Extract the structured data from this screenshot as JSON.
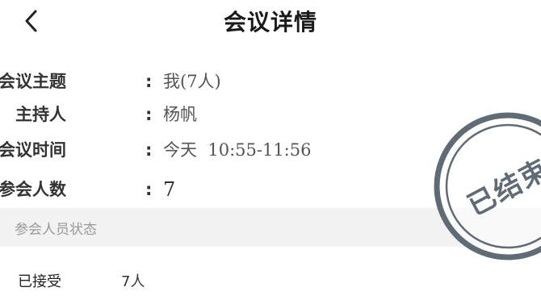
{
  "header": {
    "title": "会议详情"
  },
  "meeting": {
    "subject": {
      "label": "会议主题",
      "value": "我(7人)"
    },
    "host": {
      "label": "主持人",
      "value": "杨帆"
    },
    "time": {
      "label": "会议时间",
      "value": "今天  10:55-11:56"
    },
    "count": {
      "label": "参会人数",
      "value": "7"
    }
  },
  "colon": ":",
  "section": {
    "title": "参会人员状态"
  },
  "status": {
    "label": "已接受",
    "count": "7人"
  },
  "stamp": {
    "text": "已结束",
    "color": "#5f6b75"
  },
  "icons": {
    "back": "chevron-left-icon"
  }
}
